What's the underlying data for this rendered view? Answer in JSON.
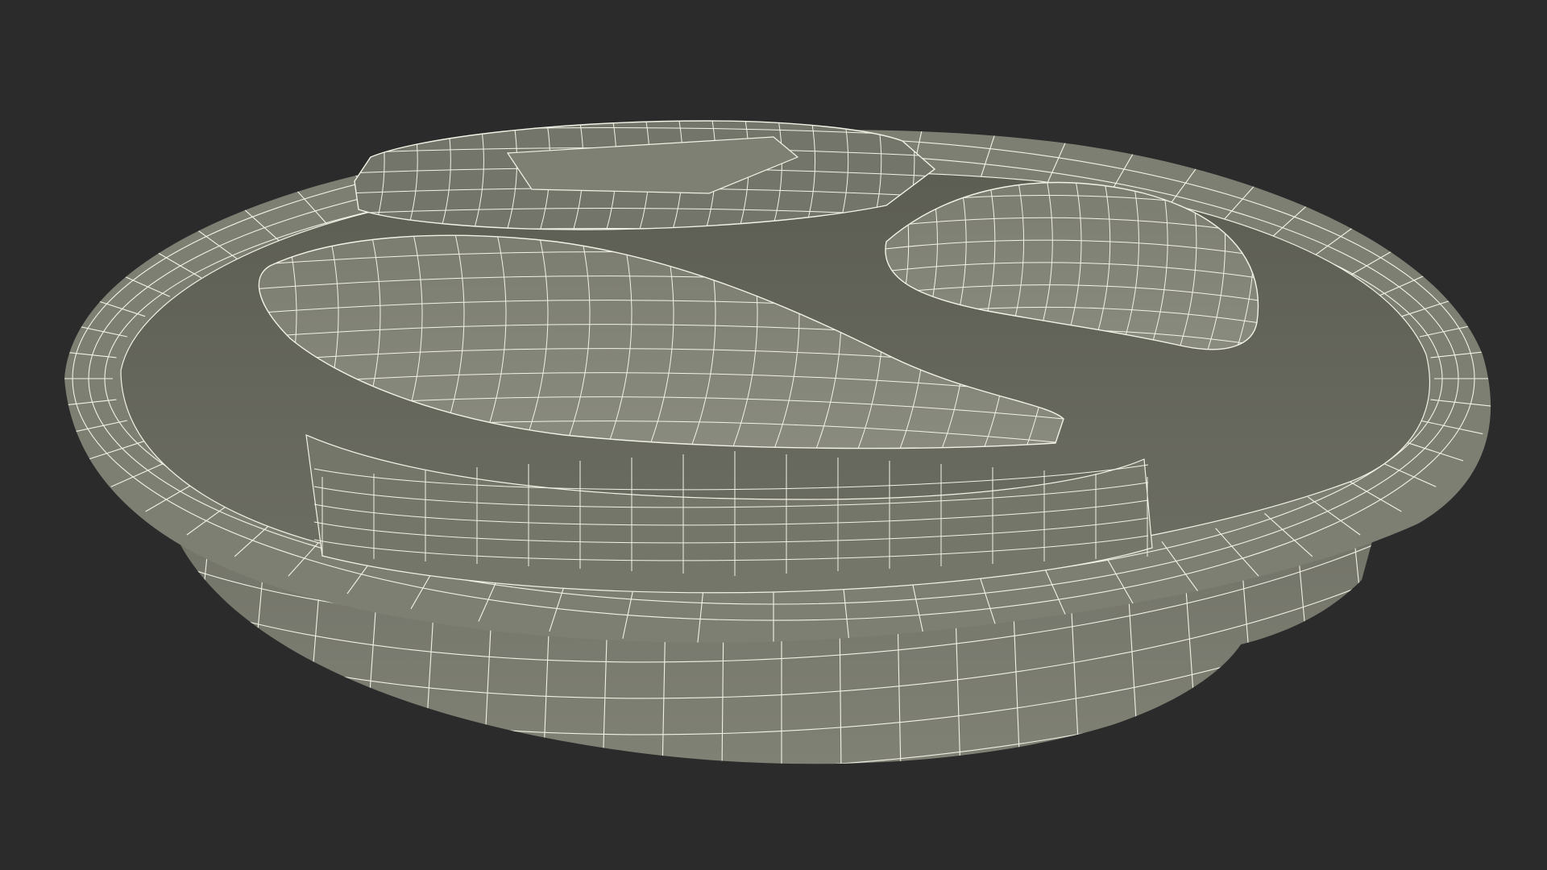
{
  "scene": {
    "background_color": "#2b2b2b",
    "surface_light": "#85867a",
    "surface_mid": "#77786b",
    "surface_dark": "#5f6055",
    "surface_shadow": "#4f5048",
    "wire_color": "#f2f2e6",
    "subject": "wireframe-render-of-divided-round-container-lid"
  }
}
